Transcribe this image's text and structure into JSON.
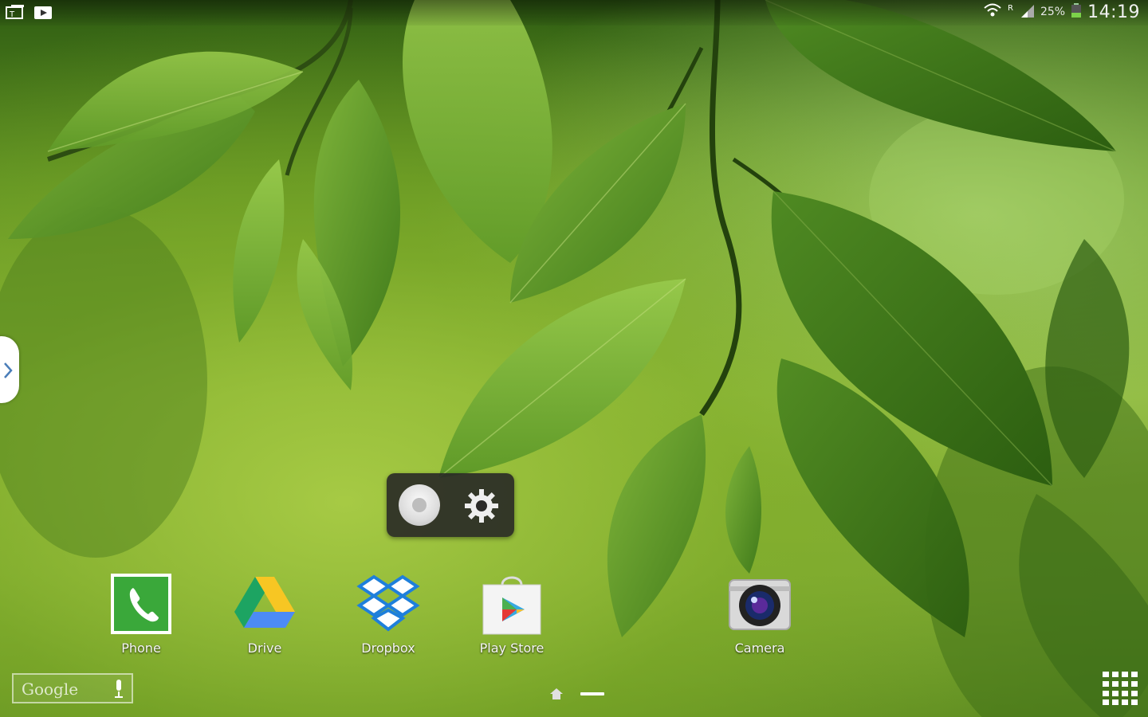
{
  "status_bar": {
    "battery_pct": "25%",
    "time": "14:19",
    "icons": [
      "screen-mirroring-icon",
      "play-store-notification-icon",
      "wifi-icon",
      "roaming-icon",
      "signal-icon",
      "battery-icon"
    ]
  },
  "side_panel": {
    "icon": "chevron-right-icon"
  },
  "floating_widget": {
    "icons": [
      "record-icon",
      "gear-icon"
    ]
  },
  "dock": {
    "apps": [
      {
        "label": "Phone",
        "icon": "phone-icon"
      },
      {
        "label": "Drive",
        "icon": "drive-icon"
      },
      {
        "label": "Dropbox",
        "icon": "dropbox-icon"
      },
      {
        "label": "Play Store",
        "icon": "play-store-icon"
      },
      {
        "label": "Camera",
        "icon": "camera-icon"
      }
    ]
  },
  "google_search": {
    "text": "Google",
    "icon": "mic-icon"
  },
  "page_indicator": {
    "icon": "home-icon"
  },
  "apps_button": {
    "icon": "apps-grid-icon"
  },
  "colors": {
    "wallpaper_dark": "#2f5d12",
    "wallpaper_light": "#8cb63a",
    "phone_green": "#3aa83a",
    "dropbox_blue": "#1e7fdb"
  }
}
